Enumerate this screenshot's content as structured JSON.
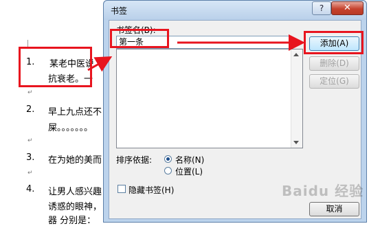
{
  "document": {
    "items": [
      {
        "number": "1.",
        "line1": "某老中医说",
        "line2": "抗衰老。一"
      },
      {
        "number": "2.",
        "line1": "早上九点还不",
        "line2": "屎。。。。。。。"
      },
      {
        "number": "3.",
        "line1": "在为她的美而"
      },
      {
        "number": "4.",
        "line1": "让男人感兴趣",
        "line2": "诱惑的眼神，",
        "line3": "器  分别是："
      }
    ],
    "pilcrow": "↵"
  },
  "dialog": {
    "title": "书签",
    "help_label": "?",
    "close_label": "✕",
    "name_label": "书签名(B):",
    "name_value": "第一条",
    "add_button": "添加(A)",
    "delete_button": "删除(D)",
    "goto_button": "定位(G)",
    "sort_label": "排序依据:",
    "sort_options": [
      {
        "label": "名称(N)",
        "selected": true
      },
      {
        "label": "位置(L)",
        "selected": false
      }
    ],
    "hidden_label": "隐藏书签(H)",
    "cancel_button": "取消"
  },
  "watermark": "Baidu 经验",
  "colors": {
    "annotation_red": "#e8141e",
    "dialog_frame": "#bcd3ec"
  }
}
